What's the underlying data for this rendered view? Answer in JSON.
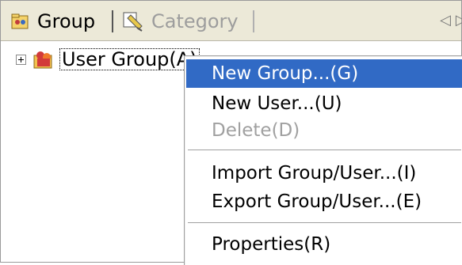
{
  "tabs": [
    {
      "label": "Group",
      "icon": "group-folder-icon",
      "active": true
    },
    {
      "label": "Category",
      "icon": "category-icon",
      "active": false
    }
  ],
  "tab_scroll": {
    "left": "◁",
    "right": "▷"
  },
  "tree": {
    "root_label": "User Group(A)"
  },
  "context_menu": {
    "items": [
      {
        "label": "New Group...(G)",
        "state": "highlighted"
      },
      {
        "label": "New User...(U)",
        "state": "normal"
      },
      {
        "label": "Delete(D)",
        "state": "disabled"
      },
      {
        "label": "Import Group/User...(I)",
        "state": "normal"
      },
      {
        "label": "Export Group/User...(E)",
        "state": "normal"
      },
      {
        "label": "Properties(R)",
        "state": "normal"
      }
    ],
    "highlight_color": "#316ac5"
  }
}
